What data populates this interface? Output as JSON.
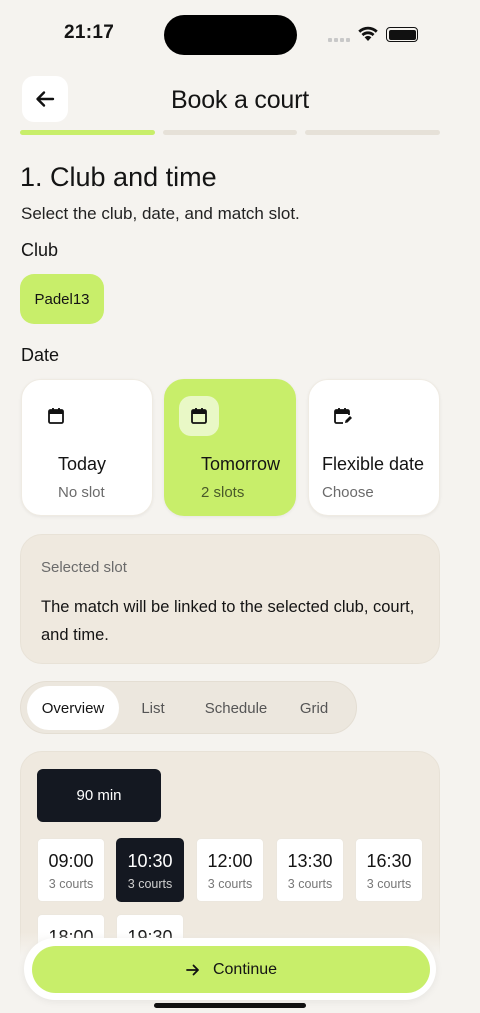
{
  "status_bar": {
    "time": "21:17"
  },
  "header": {
    "title": "Book a court"
  },
  "step": {
    "title": "1. Club and time",
    "subtitle": "Select the club, date, and match slot."
  },
  "club": {
    "label": "Club",
    "selected": "Padel13"
  },
  "date": {
    "label": "Date",
    "options": [
      {
        "title": "Today",
        "sub": "No slot"
      },
      {
        "title": "Tomorrow",
        "sub": "2 slots"
      },
      {
        "title": "Flexible date",
        "sub": "Choose"
      }
    ]
  },
  "selected_slot": {
    "label": "Selected slot",
    "text": "The match will be linked to the selected club, court, and time."
  },
  "tabs": [
    "Overview",
    "List",
    "Schedule",
    "Grid"
  ],
  "duration": "90 min",
  "slots": [
    {
      "time": "09:00",
      "courts": "3 courts"
    },
    {
      "time": "10:30",
      "courts": "3 courts"
    },
    {
      "time": "12:00",
      "courts": "3 courts"
    },
    {
      "time": "13:30",
      "courts": "3 courts"
    },
    {
      "time": "16:30",
      "courts": "3 courts"
    },
    {
      "time": "18:00",
      "courts": ""
    },
    {
      "time": "19:30",
      "courts": ""
    }
  ],
  "cta": {
    "label": "Continue"
  },
  "colors": {
    "accent": "#c8ee6a",
    "dark": "#141821",
    "background": "#f5f3ef"
  }
}
